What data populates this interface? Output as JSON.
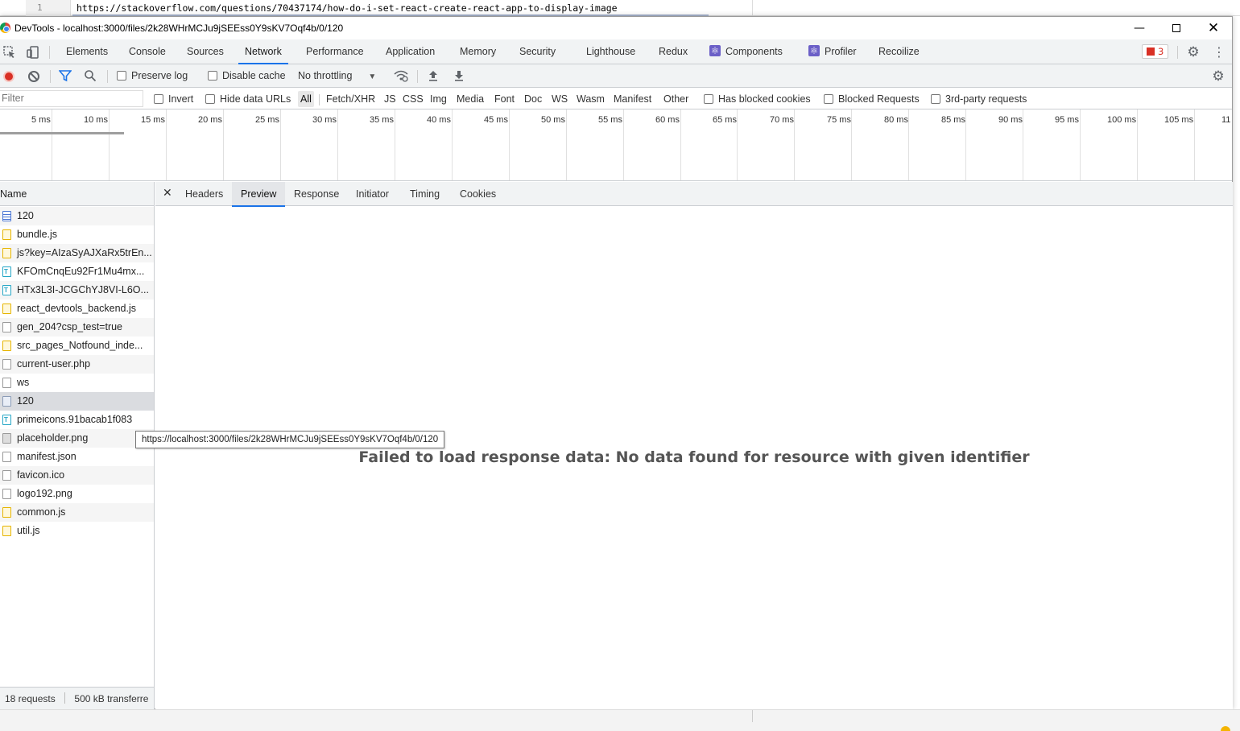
{
  "editor": {
    "line_number": "1",
    "url": "https://stackoverflow.com/questions/70437174/how-do-i-set-react-create-react-app-to-display-image"
  },
  "window": {
    "title": "DevTools - localhost:3000/files/2k28WHrMCJu9jSEEss0Y9sKV7Oqf4b/0/120"
  },
  "tabs": [
    {
      "label": "Elements"
    },
    {
      "label": "Console"
    },
    {
      "label": "Sources"
    },
    {
      "label": "Network"
    },
    {
      "label": "Performance"
    },
    {
      "label": "Application"
    },
    {
      "label": "Memory"
    },
    {
      "label": "Security"
    },
    {
      "label": "Lighthouse"
    },
    {
      "label": "Redux"
    },
    {
      "label": "Components"
    },
    {
      "label": "Profiler"
    },
    {
      "label": "Recoilize"
    }
  ],
  "error_count": "3",
  "toolbar": {
    "preserve_log": "Preserve log",
    "disable_cache": "Disable cache",
    "throttling": "No throttling"
  },
  "filter": {
    "placeholder": "Filter",
    "invert": "Invert",
    "hide_data_urls": "Hide data URLs",
    "types": [
      "All",
      "Fetch/XHR",
      "JS",
      "CSS",
      "Img",
      "Media",
      "Font",
      "Doc",
      "WS",
      "Wasm",
      "Manifest",
      "Other"
    ],
    "has_blocked_cookies": "Has blocked cookies",
    "blocked_requests": "Blocked Requests",
    "third_party": "3rd-party requests"
  },
  "timeline": {
    "ticks": [
      "5 ms",
      "10 ms",
      "15 ms",
      "20 ms",
      "25 ms",
      "30 ms",
      "35 ms",
      "40 ms",
      "45 ms",
      "50 ms",
      "55 ms",
      "60 ms",
      "65 ms",
      "70 ms",
      "75 ms",
      "80 ms",
      "85 ms",
      "90 ms",
      "95 ms",
      "100 ms",
      "105 ms",
      "11"
    ]
  },
  "list": {
    "header": "Name",
    "rows": [
      {
        "name": "120",
        "type": "doc"
      },
      {
        "name": "bundle.js",
        "type": "script"
      },
      {
        "name": "js?key=AIzaSyAJXaRx5trEn...",
        "type": "script"
      },
      {
        "name": "KFOmCnqEu92Fr1Mu4mx...",
        "type": "font"
      },
      {
        "name": "HTx3L3I-JCGChYJ8VI-L6O...",
        "type": "font"
      },
      {
        "name": "react_devtools_backend.js",
        "type": "script"
      },
      {
        "name": "gen_204?csp_test=true",
        "type": "other"
      },
      {
        "name": "src_pages_Notfound_inde...",
        "type": "script"
      },
      {
        "name": "current-user.php",
        "type": "other"
      },
      {
        "name": "ws",
        "type": "other"
      },
      {
        "name": "120",
        "type": "ws"
      },
      {
        "name": "primeicons.91bacab1f083",
        "type": "font"
      },
      {
        "name": "placeholder.png",
        "type": "img"
      },
      {
        "name": "manifest.json",
        "type": "other"
      },
      {
        "name": "favicon.ico",
        "type": "other"
      },
      {
        "name": "logo192.png",
        "type": "other"
      },
      {
        "name": "common.js",
        "type": "script"
      },
      {
        "name": "util.js",
        "type": "script"
      }
    ],
    "footer_requests": "18 requests",
    "footer_transferred": "500 kB transferre"
  },
  "detail": {
    "tabs": [
      "Headers",
      "Preview",
      "Response",
      "Initiator",
      "Timing",
      "Cookies"
    ],
    "active_tab": "Preview",
    "message": "Failed to load response data: No data found for resource with given identifier"
  },
  "tooltip": {
    "text": "https://localhost:3000/files/2k28WHrMCJu9jSEEss0Y9sKV7Oqf4b/0/120"
  }
}
